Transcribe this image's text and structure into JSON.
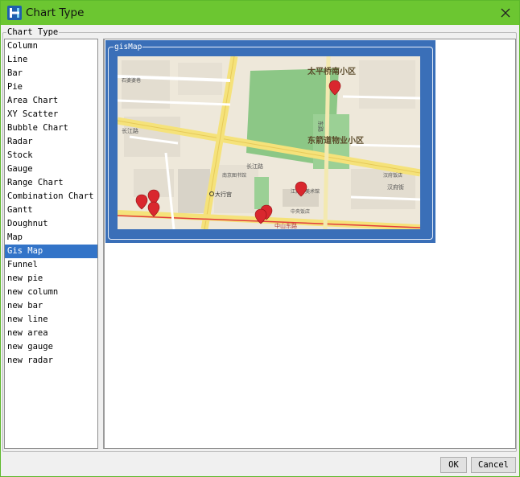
{
  "window": {
    "title": "Chart Type",
    "icon": "app-logo-icon",
    "accent_color": "#6cc631"
  },
  "group": {
    "label": "Chart Type"
  },
  "chart_types": [
    {
      "label": "Column"
    },
    {
      "label": "Line"
    },
    {
      "label": "Bar"
    },
    {
      "label": "Pie"
    },
    {
      "label": "Area Chart"
    },
    {
      "label": "XY Scatter"
    },
    {
      "label": "Bubble Chart"
    },
    {
      "label": "Radar"
    },
    {
      "label": "Stock"
    },
    {
      "label": "Gauge"
    },
    {
      "label": "Range Chart"
    },
    {
      "label": "Combination Chart"
    },
    {
      "label": "Gantt"
    },
    {
      "label": "Doughnut"
    },
    {
      "label": "Map"
    },
    {
      "label": "Gis Map",
      "selected": true
    },
    {
      "label": "Funnel"
    },
    {
      "label": "new pie"
    },
    {
      "label": "new column"
    },
    {
      "label": "new bar"
    },
    {
      "label": "new line"
    },
    {
      "label": "new area"
    },
    {
      "label": "new gauge"
    },
    {
      "label": "new radar"
    }
  ],
  "preview": {
    "tile_label": "gisMap",
    "selected_color": "#3a6fb8",
    "map_labels": {
      "district_1": "太平桥南小区",
      "district_2": "东箭道物业小区",
      "road_1": "长江路",
      "road_2": "长江路",
      "road_3": "东路",
      "road_4": "中山东路",
      "road_5": "汉府街",
      "poi_1": "大行宫",
      "poi_2": "南京图书馆",
      "poi_3": "江苏省美术馆",
      "poi_4": "汉府饭店",
      "poi_5": "中央饭店",
      "poi_6": "石婆婆巷"
    }
  },
  "buttons": {
    "ok": "OK",
    "cancel": "Cancel"
  }
}
